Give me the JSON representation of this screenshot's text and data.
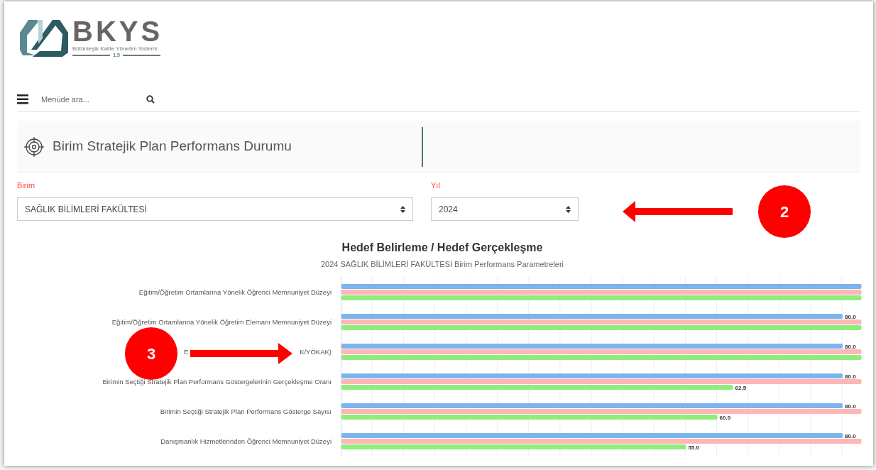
{
  "logo": {
    "name": "BKYS",
    "tagline": "Bütünleşik Kalite Yönetim Sistemi",
    "version": "1.5"
  },
  "menu_search": {
    "placeholder": "Menüde ara..."
  },
  "page_header": {
    "title": "Birim Stratejik Plan Performans Durumu"
  },
  "filters": [
    {
      "label": "Birim",
      "value": "SAĞLIK BİLİMLERİ FAKÜLTESİ",
      "kind": "wide"
    },
    {
      "label": "Yıl",
      "value": "2024",
      "kind": "narrow"
    }
  ],
  "chart": {
    "covered_label_start": "E",
    "chart_data": {
      "type": "bar",
      "orientation": "horizontal",
      "title": "Hedef Belirleme / Hedef Gerçekleşme",
      "subtitle": "2024 SAĞLIK BİLİMLERİ FAKÜLTESİ Birim Performans Parametreleri",
      "categories": [
        "Eğitim/Öğretim Ortamlarına Yönelik Öğrenci Memnuniyet Düzeyi",
        "Eğitim/Öğretim Ortamlarına Yönelik Öğretim Elemanı Memnuniyet Düzeyi",
        "K/YÖKAK)",
        "Birimin Seçtiği Stratejik Plan Performans Göstergelerinin Gerçekleşme Oranı",
        "Birimin Seçtiği Stratejik Plan Performans Gösterge Sayısı",
        "Danışmanlık Hizmetlerinden Öğrenci Memnuniyet Düzeyi"
      ],
      "xlim": [
        0,
        83
      ],
      "stacked": false,
      "series": [
        {
          "color": "#7cb5ec",
          "values": [
            83,
            80,
            80,
            80,
            80,
            80
          ],
          "value_labels": [
            null,
            "80.0",
            "80.0",
            "80.0",
            "80.0",
            "80.0"
          ]
        },
        {
          "color": "#ffb6b6",
          "values": [
            83,
            83,
            83,
            83,
            83,
            83
          ]
        },
        {
          "color": "#90ed7d",
          "values": [
            83,
            83,
            83,
            62.5,
            60,
            55
          ],
          "value_labels": [
            null,
            null,
            null,
            "62.5",
            "60.0",
            "55.0"
          ]
        }
      ]
    }
  },
  "annotations": [
    {
      "number": "2"
    },
    {
      "number": "3"
    }
  ]
}
